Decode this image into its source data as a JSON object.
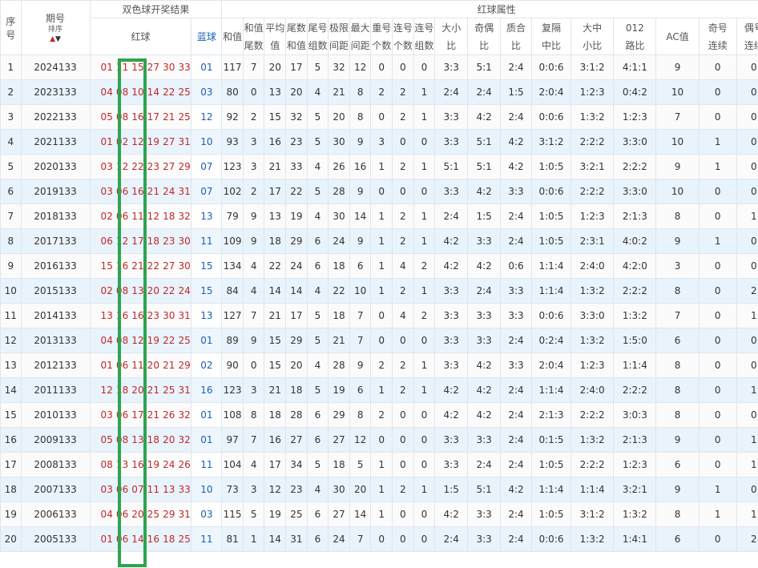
{
  "headers": {
    "seq": [
      "序",
      "号"
    ],
    "period": "期号",
    "sort": "排序",
    "draw_result": "双色球开奖结果",
    "red_ball": "红球",
    "blue_ball": "蓝球",
    "red_attr": "红球属性",
    "attrs": [
      [
        "和值"
      ],
      [
        "和值",
        "尾数"
      ],
      [
        "平均",
        "值"
      ],
      [
        "尾数",
        "和值"
      ],
      [
        "尾号",
        "组数"
      ],
      [
        "极限",
        "间距"
      ],
      [
        "最大",
        "间距"
      ],
      [
        "重号",
        "个数"
      ],
      [
        "连号",
        "个数"
      ],
      [
        "连号",
        "组数"
      ],
      [
        "大小",
        "比"
      ],
      [
        "奇偶",
        "比"
      ],
      [
        "质合",
        "比"
      ],
      [
        "复隔",
        "中比"
      ],
      [
        "大中",
        "小比"
      ],
      [
        "012",
        "路比"
      ],
      [
        "AC值"
      ],
      [
        "奇号",
        "连续"
      ],
      [
        "偶号",
        "连续"
      ]
    ]
  },
  "rows": [
    {
      "seq": "1",
      "period": "2024133",
      "red": "01 11 15 27 30 33",
      "blue": "01",
      "v": [
        "117",
        "7",
        "20",
        "17",
        "5",
        "32",
        "12",
        "0",
        "0",
        "0",
        "3:3",
        "5:1",
        "2:4",
        "0:0:6",
        "3:1:2",
        "4:1:1",
        "9",
        "0",
        "0"
      ]
    },
    {
      "seq": "2",
      "period": "2023133",
      "red": "04 08 10 14 22 25",
      "blue": "03",
      "v": [
        "80",
        "0",
        "13",
        "20",
        "4",
        "21",
        "8",
        "2",
        "2",
        "1",
        "2:4",
        "2:4",
        "1:5",
        "2:0:4",
        "1:2:3",
        "0:4:2",
        "10",
        "0",
        "0"
      ]
    },
    {
      "seq": "3",
      "period": "2022133",
      "red": "05 08 16 17 21 25",
      "blue": "12",
      "v": [
        "92",
        "2",
        "15",
        "32",
        "5",
        "20",
        "8",
        "0",
        "2",
        "1",
        "3:3",
        "4:2",
        "2:4",
        "0:0:6",
        "1:3:2",
        "1:2:3",
        "7",
        "0",
        "0"
      ]
    },
    {
      "seq": "4",
      "period": "2021133",
      "red": "01 02 12 19 27 31",
      "blue": "10",
      "v": [
        "93",
        "3",
        "16",
        "23",
        "5",
        "30",
        "9",
        "3",
        "0",
        "0",
        "3:3",
        "5:1",
        "4:2",
        "3:1:2",
        "2:2:2",
        "3:3:0",
        "10",
        "1",
        "0"
      ]
    },
    {
      "seq": "5",
      "period": "2020133",
      "red": "03 12 22 23 27 29",
      "blue": "07",
      "v": [
        "123",
        "3",
        "21",
        "33",
        "4",
        "26",
        "16",
        "1",
        "2",
        "1",
        "5:1",
        "5:1",
        "4:2",
        "1:0:5",
        "3:2:1",
        "2:2:2",
        "9",
        "1",
        "0"
      ]
    },
    {
      "seq": "6",
      "period": "2019133",
      "red": "03 06 16 21 24 31",
      "blue": "07",
      "v": [
        "102",
        "2",
        "17",
        "22",
        "5",
        "28",
        "9",
        "0",
        "0",
        "0",
        "3:3",
        "4:2",
        "3:3",
        "0:0:6",
        "2:2:2",
        "3:3:0",
        "10",
        "0",
        "0"
      ]
    },
    {
      "seq": "7",
      "period": "2018133",
      "red": "02 06 11 12 18 32",
      "blue": "13",
      "v": [
        "79",
        "9",
        "13",
        "19",
        "4",
        "30",
        "14",
        "1",
        "2",
        "1",
        "2:4",
        "1:5",
        "2:4",
        "1:0:5",
        "1:2:3",
        "2:1:3",
        "8",
        "0",
        "1"
      ]
    },
    {
      "seq": "8",
      "period": "2017133",
      "red": "06 12 17 18 23 30",
      "blue": "11",
      "v": [
        "109",
        "9",
        "18",
        "29",
        "6",
        "24",
        "9",
        "1",
        "2",
        "1",
        "4:2",
        "3:3",
        "2:4",
        "1:0:5",
        "2:3:1",
        "4:0:2",
        "9",
        "1",
        "0"
      ]
    },
    {
      "seq": "9",
      "period": "2016133",
      "red": "15 16 21 22 27 30",
      "blue": "15",
      "v": [
        "134",
        "4",
        "22",
        "24",
        "6",
        "18",
        "6",
        "1",
        "4",
        "2",
        "4:2",
        "4:2",
        "0:6",
        "1:1:4",
        "2:4:0",
        "4:2:0",
        "3",
        "0",
        "0"
      ]
    },
    {
      "seq": "10",
      "period": "2015133",
      "red": "02 08 13 20 22 24",
      "blue": "15",
      "v": [
        "84",
        "4",
        "14",
        "14",
        "4",
        "22",
        "10",
        "1",
        "2",
        "1",
        "3:3",
        "2:4",
        "3:3",
        "1:1:4",
        "1:3:2",
        "2:2:2",
        "8",
        "0",
        "2"
      ]
    },
    {
      "seq": "11",
      "period": "2014133",
      "red": "13 16 16 23 30 31",
      "blue": "13",
      "v": [
        "127",
        "7",
        "21",
        "17",
        "5",
        "18",
        "7",
        "0",
        "4",
        "2",
        "3:3",
        "3:3",
        "3:3",
        "0:0:6",
        "3:3:0",
        "1:3:2",
        "7",
        "0",
        "1"
      ]
    },
    {
      "seq": "12",
      "period": "2013133",
      "red": "04 08 12 19 22 25",
      "blue": "01",
      "v": [
        "89",
        "9",
        "15",
        "29",
        "5",
        "21",
        "7",
        "0",
        "0",
        "0",
        "3:3",
        "3:3",
        "2:4",
        "0:2:4",
        "1:3:2",
        "1:5:0",
        "6",
        "0",
        "0"
      ]
    },
    {
      "seq": "13",
      "period": "2012133",
      "red": "01 06 11 20 21 29",
      "blue": "02",
      "v": [
        "90",
        "0",
        "15",
        "20",
        "4",
        "28",
        "9",
        "2",
        "2",
        "1",
        "3:3",
        "4:2",
        "3:3",
        "2:0:4",
        "1:2:3",
        "1:1:4",
        "8",
        "0",
        "0"
      ]
    },
    {
      "seq": "14",
      "period": "2011133",
      "red": "12 18 20 21 25 31",
      "blue": "16",
      "v": [
        "123",
        "3",
        "21",
        "18",
        "5",
        "19",
        "6",
        "1",
        "2",
        "1",
        "4:2",
        "4:2",
        "2:4",
        "1:1:4",
        "2:4:0",
        "2:2:2",
        "8",
        "0",
        "1"
      ]
    },
    {
      "seq": "15",
      "period": "2010133",
      "red": "03 06 17 21 26 32",
      "blue": "01",
      "v": [
        "108",
        "8",
        "18",
        "28",
        "6",
        "29",
        "8",
        "2",
        "0",
        "0",
        "4:2",
        "4:2",
        "2:4",
        "2:1:3",
        "2:2:2",
        "3:0:3",
        "8",
        "0",
        "0"
      ]
    },
    {
      "seq": "16",
      "period": "2009133",
      "red": "05 08 13 18 20 32",
      "blue": "01",
      "v": [
        "97",
        "7",
        "16",
        "27",
        "6",
        "27",
        "12",
        "0",
        "0",
        "0",
        "3:3",
        "3:3",
        "2:4",
        "0:1:5",
        "1:3:2",
        "2:1:3",
        "9",
        "0",
        "1"
      ]
    },
    {
      "seq": "17",
      "period": "2008133",
      "red": "08 13 16 19 24 26",
      "blue": "11",
      "v": [
        "104",
        "4",
        "17",
        "34",
        "5",
        "18",
        "5",
        "1",
        "0",
        "0",
        "3:3",
        "2:4",
        "2:4",
        "1:0:5",
        "2:2:2",
        "1:2:3",
        "6",
        "0",
        "1"
      ]
    },
    {
      "seq": "18",
      "period": "2007133",
      "red": "03 06 07 11 13 33",
      "blue": "10",
      "v": [
        "73",
        "3",
        "12",
        "23",
        "4",
        "30",
        "20",
        "1",
        "2",
        "1",
        "1:5",
        "5:1",
        "4:2",
        "1:1:4",
        "1:1:4",
        "3:2:1",
        "9",
        "1",
        "0"
      ]
    },
    {
      "seq": "19",
      "period": "2006133",
      "red": "04 06 20 25 29 31",
      "blue": "03",
      "v": [
        "115",
        "5",
        "19",
        "25",
        "6",
        "27",
        "14",
        "1",
        "0",
        "0",
        "4:2",
        "3:3",
        "2:4",
        "1:0:5",
        "3:1:2",
        "1:3:2",
        "8",
        "1",
        "1"
      ]
    },
    {
      "seq": "20",
      "period": "2005133",
      "red": "01 06 14 16 18 25",
      "blue": "11",
      "v": [
        "81",
        "1",
        "14",
        "31",
        "6",
        "24",
        "7",
        "0",
        "0",
        "0",
        "2:4",
        "3:3",
        "2:4",
        "0:0:6",
        "1:3:2",
        "1:4:1",
        "6",
        "0",
        "2"
      ]
    }
  ]
}
